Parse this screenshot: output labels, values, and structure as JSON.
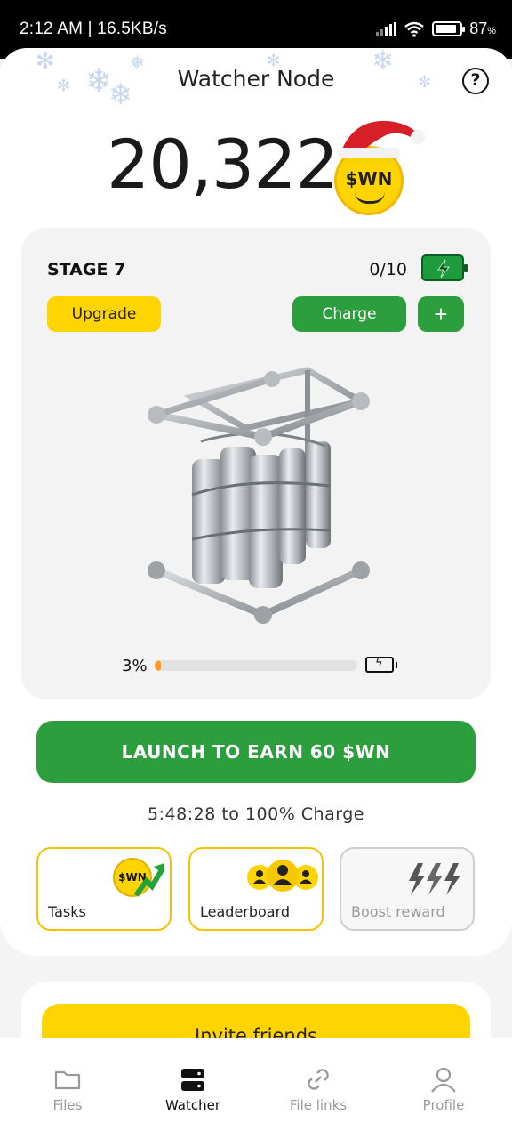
{
  "status_bar": {
    "time": "2:12 AM | 16.5KB/s",
    "battery": "87",
    "battery_unit": "%",
    "battery_level": 0.87
  },
  "header": {
    "title": "Watcher Node",
    "help_icon": "question-circle-icon"
  },
  "balance": {
    "amount": "20,322",
    "coin_label": "$WN"
  },
  "stage_card": {
    "stage_label": "STAGE 7",
    "charge_count": "0/10",
    "upgrade_label": "Upgrade",
    "charge_label": "Charge",
    "plus_label": "+",
    "progress_text": "3%",
    "progress_value": 0.03
  },
  "launch": {
    "label": "LAUNCH TO EARN 60 $WN"
  },
  "timer": {
    "text": "5:48:28 to 100% Charge"
  },
  "tiles": [
    {
      "label": "Tasks",
      "icon": "wn-coin-arrow-icon",
      "coin_text": "$WN"
    },
    {
      "label": "Leaderboard",
      "icon": "users-group-icon"
    },
    {
      "label": "Boost reward",
      "icon": "lightning-icon"
    }
  ],
  "invite": {
    "label": "Invite friends"
  },
  "nav": [
    {
      "label": "Files",
      "icon": "folder-icon"
    },
    {
      "label": "Watcher",
      "icon": "server-icon"
    },
    {
      "label": "File links",
      "icon": "link-icon"
    },
    {
      "label": "Profile",
      "icon": "user-icon"
    }
  ],
  "colors": {
    "accent_green": "#2d9e3e",
    "accent_yellow": "#ffd400",
    "progress_orange": "#ff9a1f"
  }
}
